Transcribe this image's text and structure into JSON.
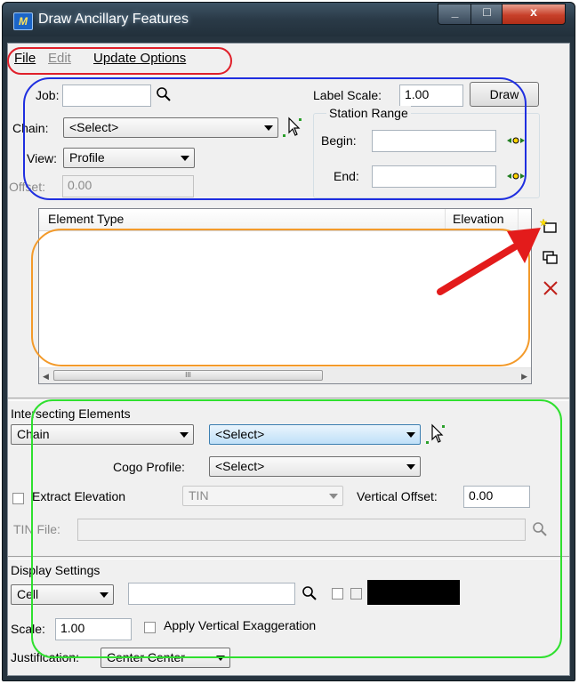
{
  "window": {
    "title": "Draw Ancillary Features",
    "min": "_",
    "max": "□",
    "close": "x",
    "app_icon": "M"
  },
  "menu": {
    "file": "File",
    "edit": "Edit",
    "update": "Update Options"
  },
  "top": {
    "job_label": "Job:",
    "job_value": "",
    "label_scale_label": "Label Scale:",
    "label_scale_value": "1.00",
    "draw_button": "Draw",
    "chain_label": "Chain:",
    "chain_value": "<Select>",
    "view_label": "View:",
    "view_value": "Profile",
    "offset_label": "Offset:",
    "offset_value": "0.00",
    "station_range": "Station Range",
    "begin_label": "Begin:",
    "begin_value": "",
    "end_label": "End:",
    "end_value": ""
  },
  "list": {
    "col_element_type": "Element Type",
    "col_elevation": "Elevation",
    "thumb_grip": "III",
    "left_arrow": "◀",
    "right_arrow": "▶"
  },
  "intersecting": {
    "title": "Intersecting Elements",
    "type_value": "Chain",
    "select_value": "<Select>",
    "cogo_label": "Cogo Profile:",
    "cogo_value": "<Select>",
    "extract_label": "Extract Elevation",
    "tin_value": "TIN",
    "vertical_offset_label": "Vertical Offset:",
    "vertical_offset_value": "0.00",
    "tin_file_label": "TIN File:",
    "tin_file_value": ""
  },
  "display": {
    "title": "Display Settings",
    "cell_value": "Cell",
    "cell_name_value": "",
    "color_swatch": "#000000",
    "scale_label": "Scale:",
    "scale_value": "1.00",
    "apply_vertical_label": "Apply Vertical Exaggeration",
    "justification_label": "Justification:",
    "justification_value": "Center Center"
  },
  "annotations": {
    "menu_ring": "#e0202a",
    "top_ring": "#1f2fe0",
    "list_ring": "#f39a2a",
    "bottom_ring": "#2fe02f",
    "arrow": "#e31b1b"
  }
}
